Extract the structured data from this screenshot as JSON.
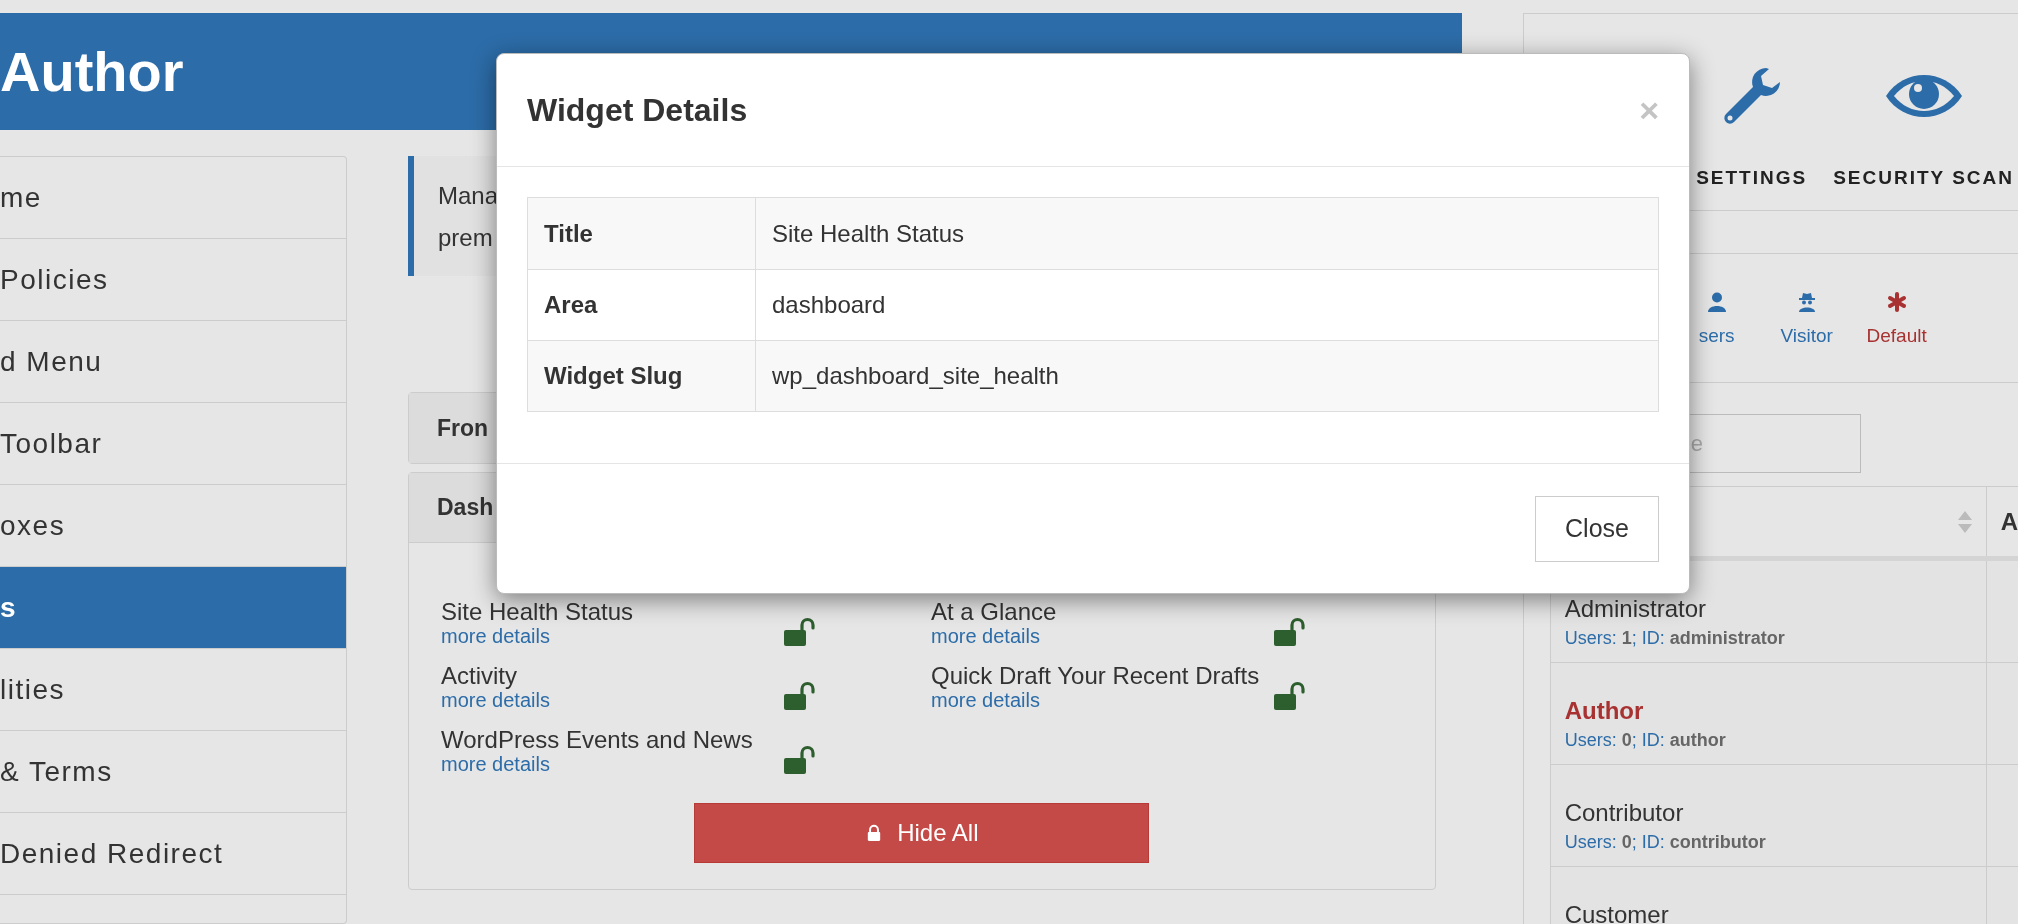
{
  "header": {
    "title": "Author"
  },
  "sidebar": {
    "items": [
      {
        "label": "me",
        "selected": false
      },
      {
        "label": "Policies",
        "selected": false
      },
      {
        "label": "d Menu",
        "selected": false
      },
      {
        "label": "Toolbar",
        "selected": false
      },
      {
        "label": "oxes",
        "selected": false
      },
      {
        "label": "s",
        "selected": true
      },
      {
        "label": "lities",
        "selected": false
      },
      {
        "label": "& Terms",
        "selected": false
      },
      {
        "label": "Denied Redirect",
        "selected": false
      }
    ]
  },
  "notice": {
    "lines": [
      "Mana",
      "prem"
    ]
  },
  "panels": [
    {
      "title": "Fron",
      "expanded": false
    },
    {
      "title": "Dash",
      "expanded": true,
      "widgets": [
        {
          "title": "Site Health Status",
          "link": "more details",
          "locked": false
        },
        {
          "title": "At a Glance",
          "link": "more details",
          "locked": false
        },
        {
          "title": "Activity",
          "link": "more details",
          "locked": false
        },
        {
          "title": "Quick Draft Your Recent Drafts",
          "link": "more details",
          "locked": false
        },
        {
          "title": "WordPress Events and News",
          "link": "more details",
          "locked": false
        }
      ],
      "hide_all_button": "Hide All"
    }
  ],
  "right_panel": {
    "tools": [
      {
        "kind": "settings",
        "label": "SETTINGS"
      },
      {
        "kind": "scan",
        "label": "SECURITY SCAN"
      }
    ],
    "role_tabs": [
      {
        "kind": "users",
        "label": "sers"
      },
      {
        "kind": "visitor",
        "label": "Visitor"
      },
      {
        "kind": "default",
        "label": "Default"
      }
    ],
    "search": {
      "placeholder": "e"
    },
    "roles_table": {
      "column_2_header": "A",
      "rows": [
        {
          "name": "Administrator",
          "meta": "Users: **1**; ID: **administrator**",
          "selected": false
        },
        {
          "name": "Author",
          "meta": "Users: **0**; ID: **author**",
          "selected": true
        },
        {
          "name": "Contributor",
          "meta": "Users: **0**; ID: **contributor**",
          "selected": false
        },
        {
          "name": "Customer",
          "selected": false
        }
      ]
    }
  },
  "modal": {
    "title": "Widget Details",
    "close_symbol": "×",
    "rows": [
      {
        "label": "Title",
        "value": "Site Health Status"
      },
      {
        "label": "Area",
        "value": "dashboard"
      },
      {
        "label": "Widget Slug",
        "value": "wp_dashboard_site_health"
      }
    ],
    "close_button": "Close"
  }
}
